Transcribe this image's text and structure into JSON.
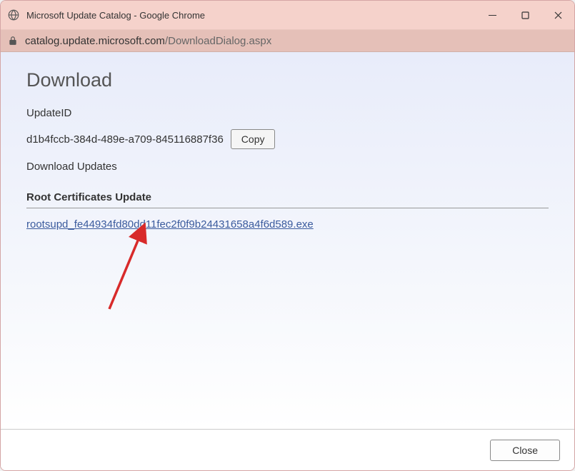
{
  "titlebar": {
    "title": "Microsoft Update Catalog - Google Chrome"
  },
  "addressbar": {
    "domain": "catalog.update.microsoft.com",
    "path": "/DownloadDialog.aspx"
  },
  "page": {
    "heading": "Download",
    "updateid_label": "UpdateID",
    "updateid_value": "d1b4fccb-384d-489e-a709-845116887f36",
    "copy_label": "Copy",
    "download_updates_label": "Download Updates",
    "section_title": "Root Certificates Update",
    "download_link_text": "rootsupd_fe44934fd80dd11fec2f0f9b24431658a4f6d589.exe"
  },
  "footer": {
    "close_label": "Close"
  }
}
